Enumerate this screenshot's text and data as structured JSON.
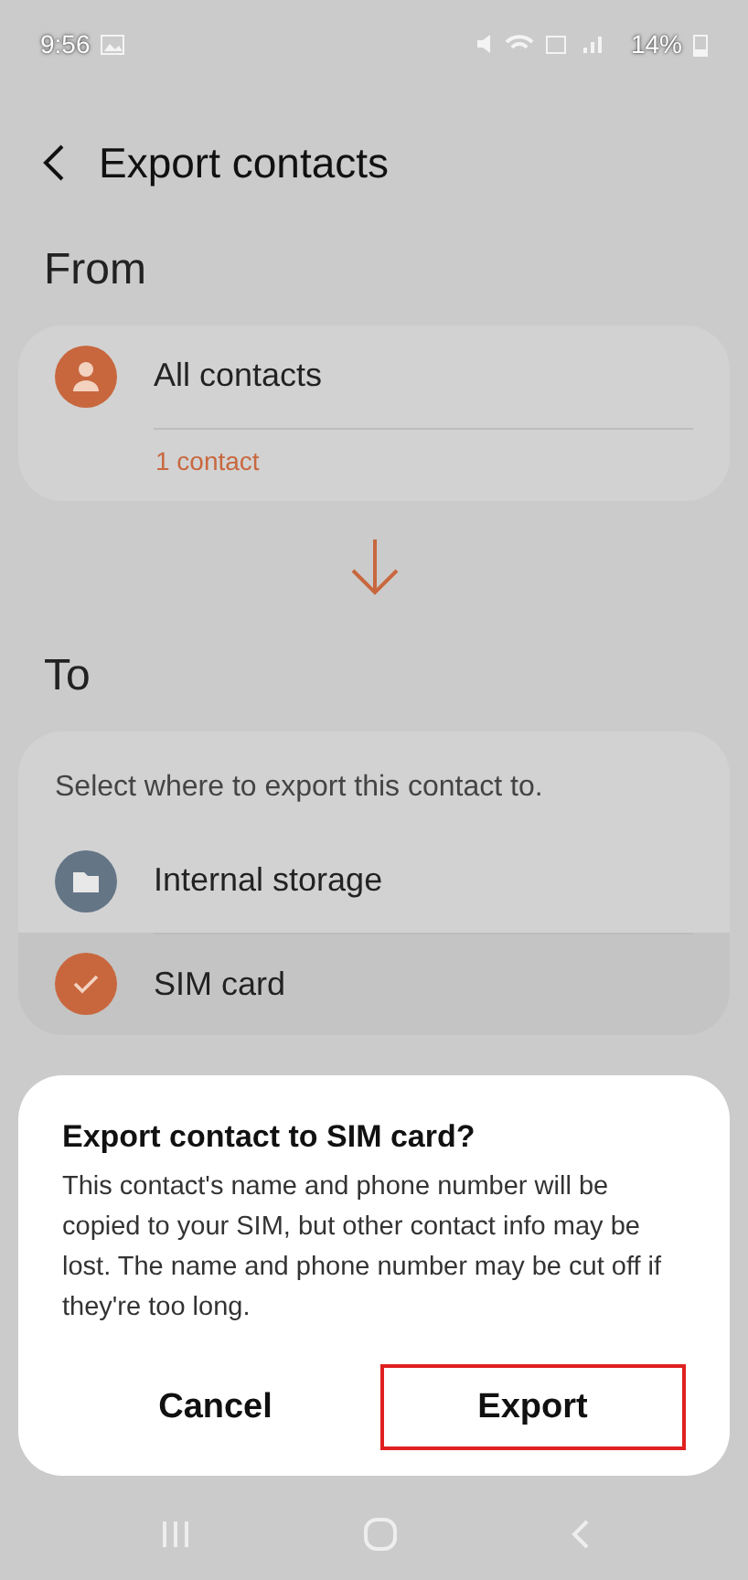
{
  "status_bar": {
    "time": "9:56",
    "battery": "14%"
  },
  "header": {
    "title": "Export contacts"
  },
  "from": {
    "heading": "From",
    "source": {
      "label": "All contacts",
      "count": "1 contact"
    }
  },
  "to": {
    "heading": "To",
    "prompt": "Select where to export this contact to.",
    "destinations": [
      {
        "label": "Internal storage",
        "kind": "folder",
        "selected": false
      },
      {
        "label": "SIM card",
        "kind": "sim",
        "selected": true
      }
    ]
  },
  "dialog": {
    "title": "Export contact to SIM card?",
    "message": "This contact's name and phone number will be copied to your SIM, but other contact info may be lost. The name and phone number may be cut off if they're too long.",
    "buttons": [
      {
        "label": "Cancel",
        "highlighted": false
      },
      {
        "label": "Export",
        "highlighted": true
      }
    ]
  }
}
